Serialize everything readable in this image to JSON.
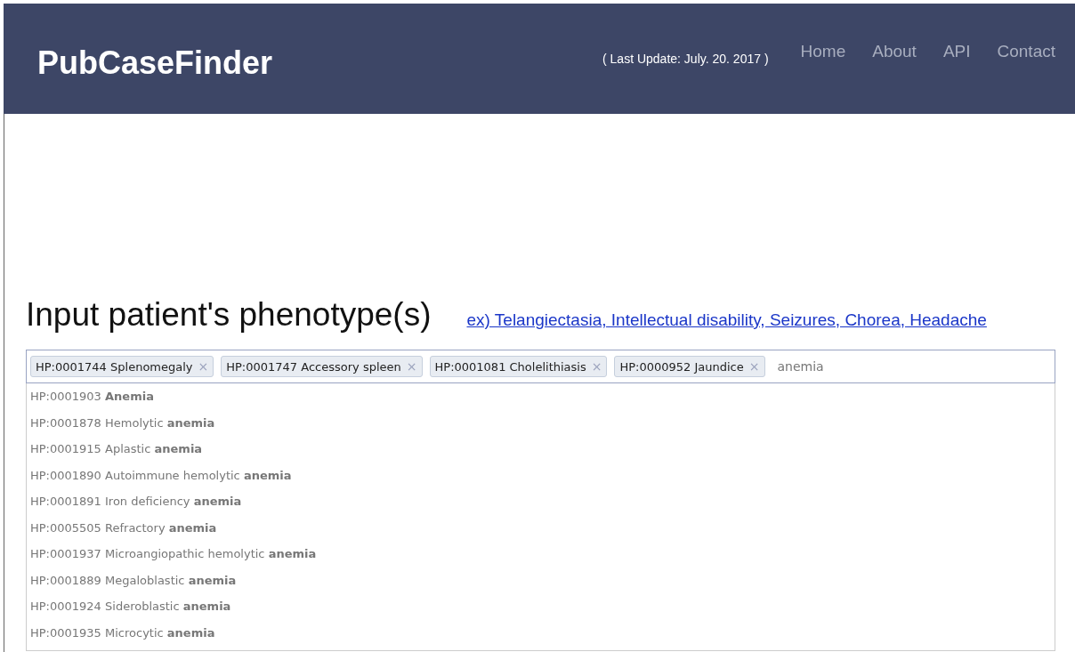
{
  "header": {
    "logo": "PubCaseFinder",
    "last_update": "( Last Update: July. 20. 2017 )",
    "nav": [
      "Home",
      "About",
      "API",
      "Contact"
    ]
  },
  "heading": "Input patient's phenotype(s)",
  "example_link": "ex) Telangiectasia, Intellectual disability, Seizures, Chorea, Headache",
  "phenotype_field": {
    "tags": [
      {
        "label": "HP:0001744 Splenomegaly",
        "remove": "×"
      },
      {
        "label": "HP:0001747 Accessory spleen",
        "remove": "×"
      },
      {
        "label": "HP:0001081 Cholelithiasis",
        "remove": "×"
      },
      {
        "label": "HP:0000952 Jaundice",
        "remove": "×"
      }
    ],
    "value": "anemia"
  },
  "suggestions": [
    "HP:0001903 **Anemia**",
    "HP:0001878 Hemolytic **anemia**",
    "HP:0001915 Aplastic **anemia**",
    "HP:0001890 Autoimmune hemolytic **anemia**",
    "HP:0001891 Iron deficiency **anemia**",
    "HP:0005505 Refractory **anemia**",
    "HP:0001937 Microangiopathic hemolytic **anemia**",
    "HP:0001889 Megaloblastic **anemia**",
    "HP:0001924 Sideroblastic **anemia**",
    "HP:0001935 Microcytic **anemia**"
  ]
}
